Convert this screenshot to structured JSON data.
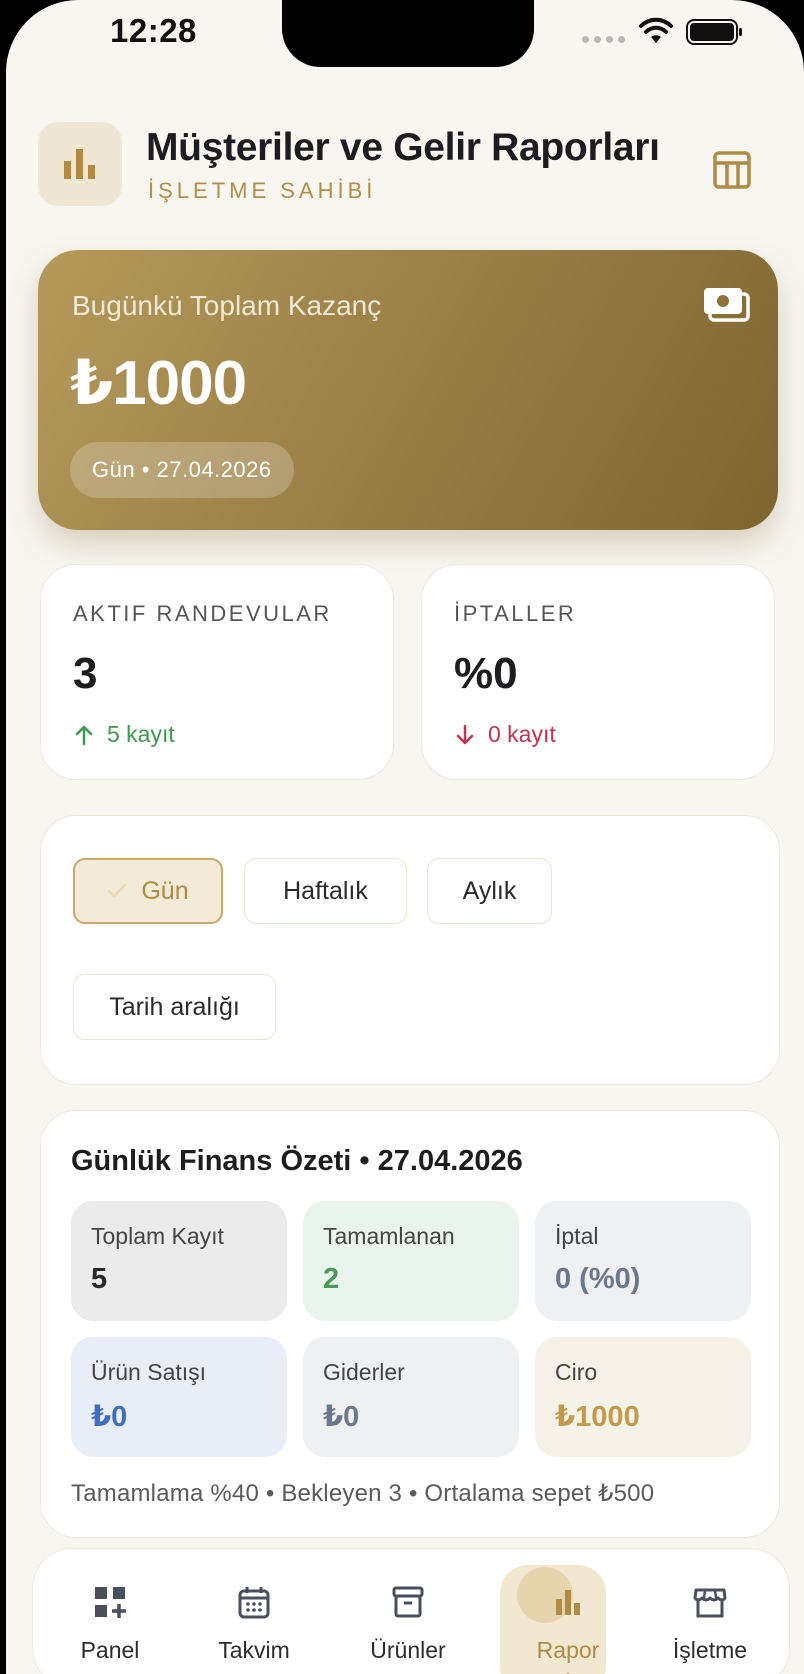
{
  "status_bar": {
    "time": "12:28"
  },
  "header": {
    "title": "Müşteriler ve Gelir Raporları",
    "subtitle": "İŞLETME SAHİBİ"
  },
  "hero": {
    "label": "Bugünkü Toplam Kazanç",
    "amount": "₺1000",
    "chip": "Gün • 27.04.2026"
  },
  "stats": [
    {
      "label": "AKTIF RANDEVULAR",
      "value": "3",
      "delta": "5 kayıt",
      "trend": "up"
    },
    {
      "label": "İPTALLER",
      "value": "%0",
      "delta": "0 kayıt",
      "trend": "down"
    }
  ],
  "filters": {
    "selected": "Gün",
    "day": "Gün",
    "week": "Haftalık",
    "month": "Aylık",
    "range": "Tarih aralığı"
  },
  "finance": {
    "title": "Günlük Finans Özeti • 27.04.2026",
    "tiles": [
      {
        "label": "Toplam Kayıt",
        "value": "5",
        "color": "#2a2a2a"
      },
      {
        "label": "Tamamlanan",
        "value": "2",
        "color": "#4a9a57"
      },
      {
        "label": "İptal",
        "value": "0 (%0)",
        "color": "#6b778c"
      },
      {
        "label": "Ürün Satışı",
        "value": "₺0",
        "color": "#3f6ec0"
      },
      {
        "label": "Giderler",
        "value": "₺0",
        "color": "#6b778c"
      },
      {
        "label": "Ciro",
        "value": "₺1000",
        "color": "#c49a4a"
      }
    ],
    "footer": "Tamamlama %40 • Bekleyen 3 • Ortalama sepet ₺500"
  },
  "nav": {
    "items": [
      {
        "label": "Panel",
        "icon": "dashboard-add-icon"
      },
      {
        "label": "Takvim",
        "icon": "calendar-icon"
      },
      {
        "label": "Ürünler",
        "icon": "archive-box-icon"
      },
      {
        "label": "Rapor",
        "icon": "bar-chart-icon",
        "active": true
      },
      {
        "label": "İşletme",
        "icon": "storefront-icon"
      }
    ]
  },
  "colors": {
    "accent": "#b08b46",
    "hero_gradient_start": "#b59a5b",
    "hero_gradient_end": "#7e6530",
    "positive": "#3e9a4e",
    "negative": "#c2344f"
  }
}
